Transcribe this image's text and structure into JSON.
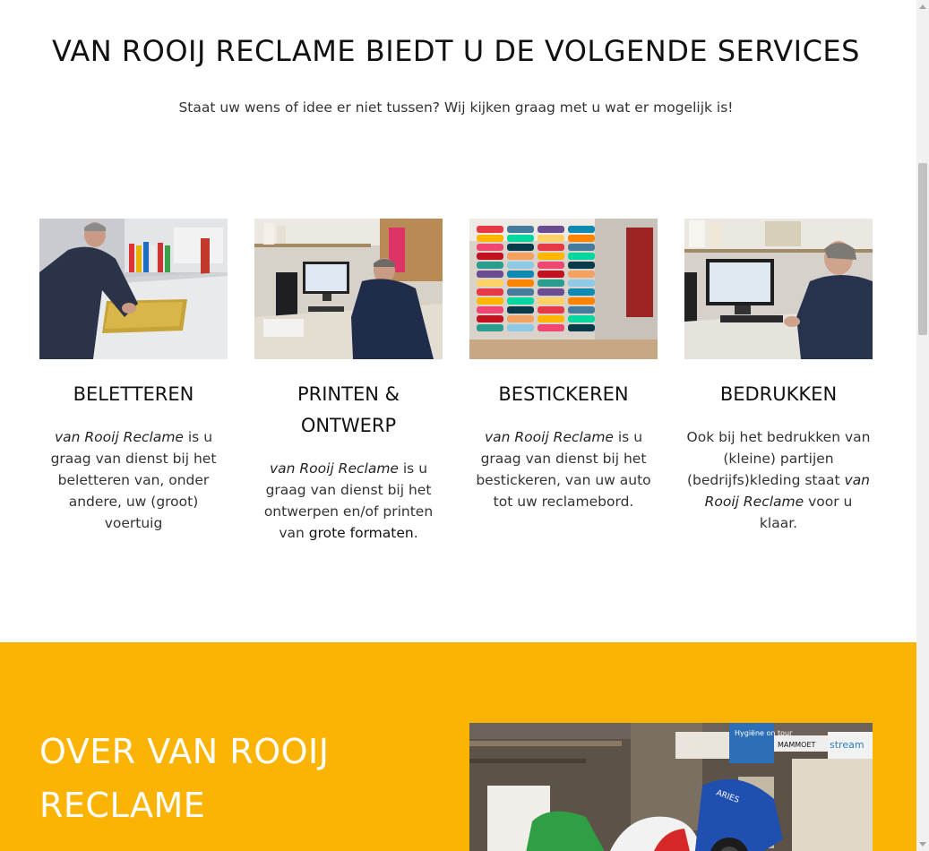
{
  "services": {
    "title": "VAN ROOIJ RECLAME BIEDT U DE VOLGENDE SERVICES",
    "subtitle": "Staat uw wens of idee er niet tussen? Wij kijken graag met u wat er mogelijk is!",
    "cards": [
      {
        "title": "BELETTEREN",
        "brand": "van Rooij Reclame",
        "text": " is u graag van dienst bij het beletteren van, onder andere, uw (groot) voertuig"
      },
      {
        "title": "PRINTEN & ONTWERP",
        "brand": "van Rooij Reclame",
        "text": " is u graag van dienst bij het ontwerpen en/of printen van ",
        "strong": "grote formaten",
        "tail": "."
      },
      {
        "title": "BESTICKEREN",
        "brand": "van Rooij Reclame",
        "text": " is u graag van dienst bij het bestickeren, van uw auto tot uw reclamebord."
      },
      {
        "title": "BEDRUKKEN",
        "lead": "Ook bij het bedrukken van (kleine) partijen (bedrijfs)kleding staat ",
        "brand": "van Rooij Reclame",
        "text": " voor u klaar."
      }
    ]
  },
  "about": {
    "title": "OVER VAN ROOIJ RECLAME",
    "photo_signs": [
      "Hygiëne on tour",
      "MAMMOET",
      "stream",
      "ARIES"
    ]
  },
  "colors": {
    "accent": "#fcb404",
    "text_dark": "#111111",
    "text_body": "#333333"
  }
}
